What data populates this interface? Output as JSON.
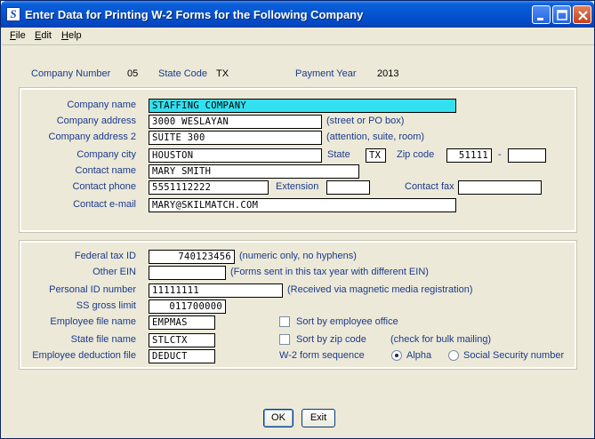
{
  "window": {
    "title": "Enter Data for Printing W-2 Forms for the Following Company",
    "app_icon_letter": "S"
  },
  "menu": [
    {
      "label": "File",
      "key": "F",
      "rest": "ile"
    },
    {
      "label": "Edit",
      "key": "E",
      "rest": "dit"
    },
    {
      "label": "Help",
      "key": "H",
      "rest": "elp"
    }
  ],
  "header": {
    "company_number_label": "Company Number",
    "company_number": "05",
    "state_code_label": "State Code",
    "state_code": "TX",
    "payment_year_label": "Payment Year",
    "payment_year": "2013"
  },
  "company": {
    "name_label": "Company name",
    "name": "STAFFING COMPANY",
    "address_label": "Company address",
    "address": "3000 WESLAYAN",
    "address_hint": "(street or PO box)",
    "address2_label": "Company address 2",
    "address2": "SUITE 300",
    "address2_hint": "(attention, suite, room)",
    "city_label": "Company city",
    "city": "HOUSTON",
    "state_label": "State",
    "state": "TX",
    "zip_label": "Zip code",
    "zip": "51111",
    "zip_dash": "-",
    "zip_ext": "",
    "contact_name_label": "Contact name",
    "contact_name": "MARY SMITH",
    "contact_phone_label": "Contact phone",
    "contact_phone": "5551112222",
    "extension_label": "Extension",
    "extension": "",
    "contact_fax_label": "Contact fax",
    "contact_fax": "",
    "contact_email_label": "Contact e-mail",
    "contact_email": "MARY@SKILMATCH.COM"
  },
  "tax": {
    "federal_id_label": "Federal tax ID",
    "federal_id": "740123456",
    "federal_id_hint": "(numeric only, no hyphens)",
    "other_ein_label": "Other EIN",
    "other_ein": "",
    "other_ein_hint": "(Forms sent in this tax year with different EIN)",
    "personal_id_label": "Personal ID number",
    "personal_id": "11111111",
    "personal_id_hint": "(Received via magnetic media registration)",
    "ss_limit_label": "SS gross limit",
    "ss_limit": "011700000",
    "employee_file_label": "Employee file name",
    "employee_file": "EMPMAS",
    "state_file_label": "State file name",
    "state_file": "STLCTX",
    "deduction_file_label": "Employee deduction file",
    "deduction_file": "DEDUCT",
    "sort_office_label": "Sort by employee office",
    "sort_office_checked": false,
    "sort_zip_label": "Sort by zip code",
    "sort_zip_checked": false,
    "bulk_hint": "(check for bulk mailing)",
    "sequence_label": "W-2 form sequence",
    "sequence_options": [
      "Alpha",
      "Social Security number"
    ],
    "sequence_selected": "Alpha"
  },
  "buttons": {
    "ok": "OK",
    "exit": "Exit"
  }
}
